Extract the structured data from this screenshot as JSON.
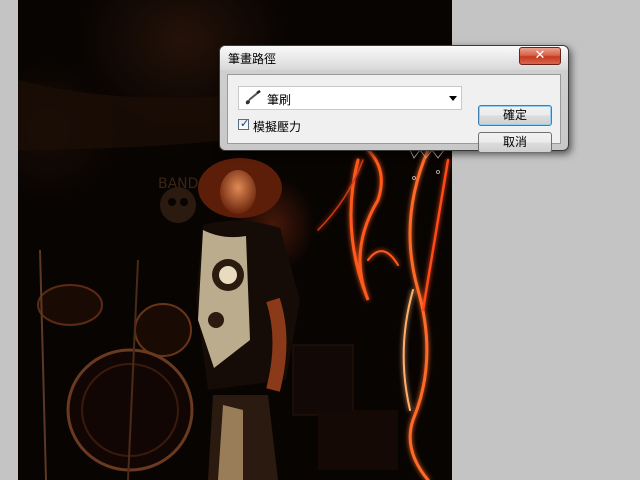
{
  "dialog": {
    "title": "筆畫路徑",
    "close_symbol": "✕",
    "tool_select": {
      "icon": "brush-icon",
      "value": "筆刷"
    },
    "simulate_pressure": {
      "label": "模擬壓力",
      "checked": true
    },
    "ok_label": "確定",
    "cancel_label": "取消"
  },
  "colors": {
    "app_background": "#c4c4c4",
    "light_trail": "#ff5a1e",
    "ok_button_focus": "#3c7fb1",
    "close_button": "#c8391f"
  }
}
